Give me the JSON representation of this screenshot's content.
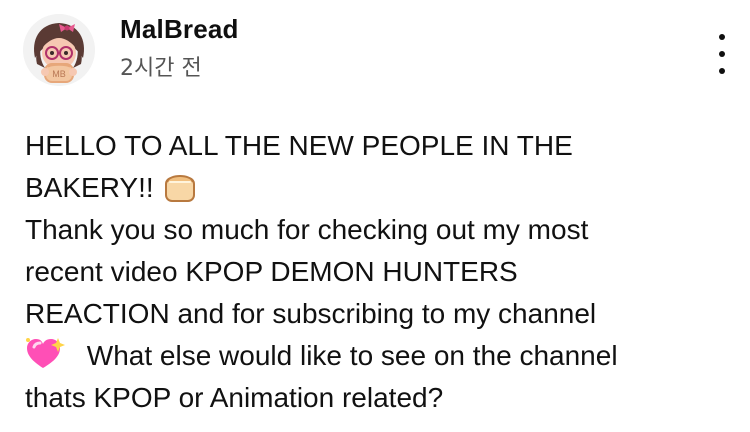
{
  "post": {
    "author": "MalBread",
    "timestamp": "2시간 전",
    "menu_icon": "more-vertical-icon",
    "avatar_icon": "avatar-illustration-holding-bread-icon",
    "lines": [
      "HELLO TO ALL THE NEW PEOPLE IN THE",
      "BAKERY!!",
      "Thank you so much for checking out my most",
      "recent video KPOP DEMON HUNTERS",
      "REACTION and for subscribing to my channel",
      "What else would like to see on the channel",
      "thats KPOP or Animation related?"
    ],
    "emojis": {
      "after_line_2": "bread-emoji",
      "before_line_6": "sparkling-heart-emoji"
    }
  }
}
